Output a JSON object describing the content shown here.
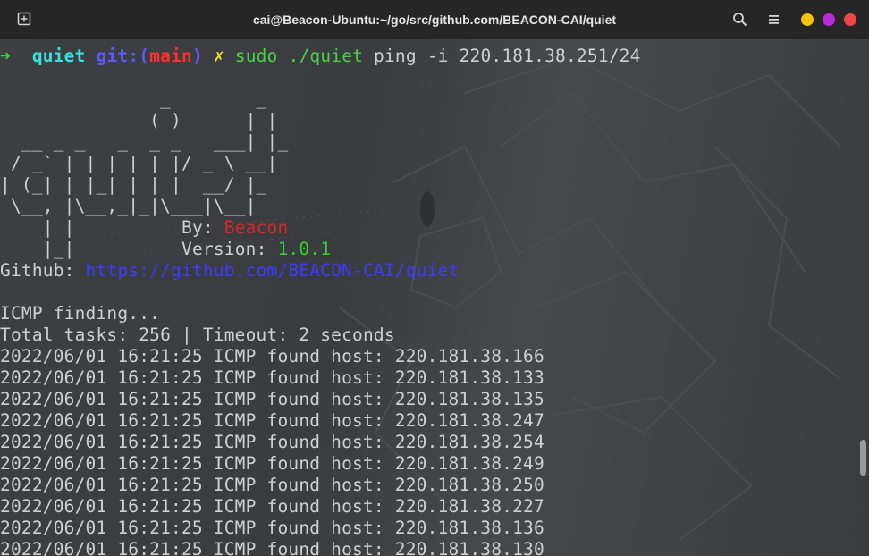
{
  "window": {
    "title": "cai@Beacon-Ubuntu:~/go/src/github.com/BEACON-CAI/quiet",
    "controls": {
      "minimize_color": "#f5c211",
      "maximize_color": "#b82bd9",
      "close_color": "#f04545"
    }
  },
  "prompt": {
    "arrow": "➜",
    "dir": "quiet",
    "git_label": "git:(",
    "branch": "main",
    "git_close": ")",
    "dirty_mark": "✗",
    "sudo": "sudo",
    "program": "./quiet",
    "args": "ping -i 220.181.38.251/24"
  },
  "banner": [
    "               _        _",
    "              ( )      | |",
    "  __ _ _   _  _ _   ___| |_",
    " / _` | | | | | |/ _ \\ __|",
    "| (_| | |_| | | |  __/ |_",
    " \\__, |\\__,_|_|\\___|\\__|",
    "    | |"
  ],
  "banner_last": "    |_|",
  "by_label": "By: ",
  "author": "Beacon",
  "version_label": "Version: ",
  "version": "1.0.1",
  "github_label": "Github: ",
  "github_url": "https://github.com/BEACON-CAI/quiet",
  "status": {
    "finding": "ICMP finding...",
    "tasks": "Total tasks: 256 | Timeout: 2 seconds"
  },
  "results": [
    "2022/06/01 16:21:25 ICMP found host: 220.181.38.166",
    "2022/06/01 16:21:25 ICMP found host: 220.181.38.133",
    "2022/06/01 16:21:25 ICMP found host: 220.181.38.135",
    "2022/06/01 16:21:25 ICMP found host: 220.181.38.247",
    "2022/06/01 16:21:25 ICMP found host: 220.181.38.254",
    "2022/06/01 16:21:25 ICMP found host: 220.181.38.249",
    "2022/06/01 16:21:25 ICMP found host: 220.181.38.250",
    "2022/06/01 16:21:25 ICMP found host: 220.181.38.227",
    "2022/06/01 16:21:25 ICMP found host: 220.181.38.136",
    "2022/06/01 16:21:25 ICMP found host: 220.181.38.130"
  ]
}
